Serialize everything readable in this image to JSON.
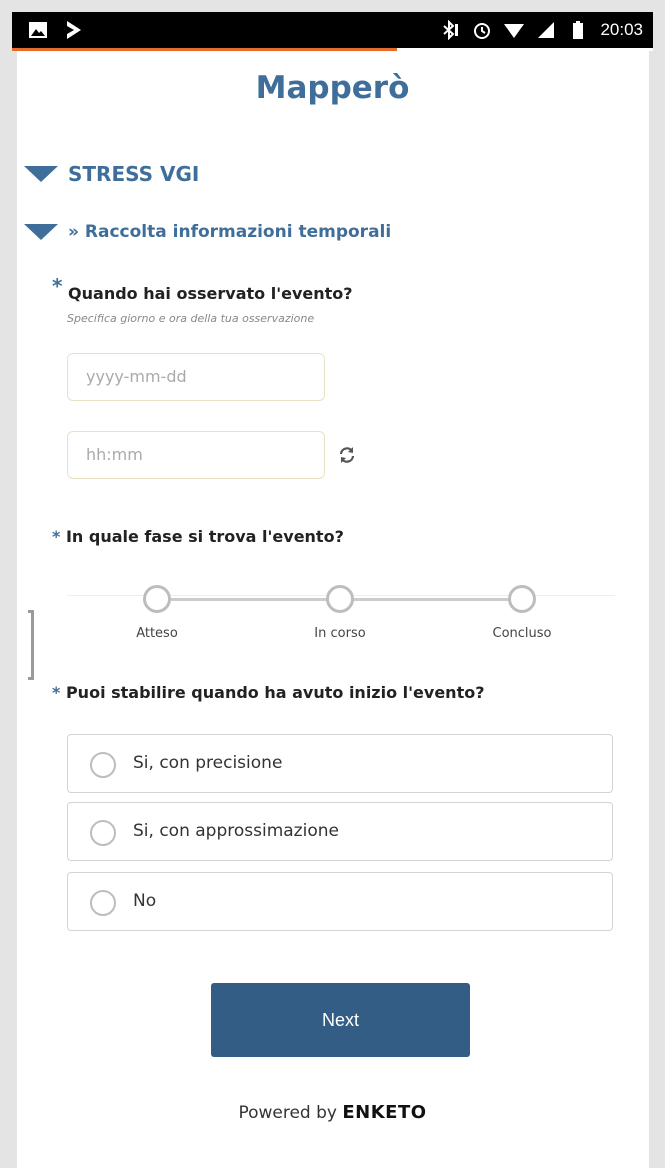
{
  "status_bar": {
    "time": "20:03",
    "left_icons": [
      "image-icon",
      "flash-tray-icon"
    ],
    "right_icons": [
      "bluetooth-icon",
      "alarm-icon",
      "wifi-icon",
      "signal-icon",
      "battery-icon"
    ]
  },
  "form": {
    "title": "Mapperò",
    "progress_fraction": 0.6,
    "group": {
      "label": "STRESS VGI"
    },
    "subgroup": {
      "label": "» Raccolta informazioni temporali"
    },
    "q1": {
      "required_marker": "*",
      "label": "Quando hai osservato l'evento?",
      "hint": "Specifica giorno e ora della tua osservazione",
      "date_placeholder": "yyyy-mm-dd",
      "time_placeholder": "hh:mm",
      "refresh_icon": "refresh-icon"
    },
    "q2": {
      "required_marker": "*",
      "label": "In quale fase si trova l'evento?",
      "steps": [
        "Atteso",
        "In corso",
        "Concluso"
      ]
    },
    "q3": {
      "required_marker": "*",
      "label": "Puoi stabilire quando ha avuto inizio l'evento?",
      "options": [
        "Si, con precisione",
        "Si, con approssimazione",
        "No"
      ]
    },
    "next_label": "Next",
    "powered_prefix": "Powered by",
    "powered_brand": "ENKETO"
  },
  "colors": {
    "accent": "#3e6e99",
    "button": "#345d85",
    "progress": "#e36b2c"
  }
}
